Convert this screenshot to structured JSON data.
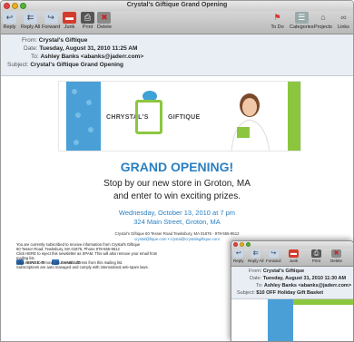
{
  "main_window": {
    "title": "Crystal's Giftique Grand Opening",
    "toolbar_left": [
      {
        "label": "Reply",
        "icon": "reply-icon"
      },
      {
        "label": "Reply All",
        "icon": "reply-all-icon"
      },
      {
        "label": "Forward",
        "icon": "forward-icon"
      },
      {
        "label": "Junk",
        "icon": "junk-icon"
      },
      {
        "label": "Print",
        "icon": "print-icon"
      },
      {
        "label": "Delete",
        "icon": "delete-icon"
      }
    ],
    "toolbar_right": [
      {
        "label": "To Do",
        "icon": "todo-flag-icon"
      },
      {
        "label": "Categories",
        "icon": "categories-icon"
      },
      {
        "label": "Projects",
        "icon": "projects-icon"
      },
      {
        "label": "Links",
        "icon": "links-icon"
      }
    ],
    "headers": {
      "from_label": "From:",
      "from_value": "Crystal's Giftique",
      "date_label": "Date:",
      "date_value": "Tuesday, August 31, 2010 11:25 AM",
      "to_label": "To:",
      "to_value": "Ashley Banks <abanks@jaderr.com>",
      "subject_label": "Subject:",
      "subject_value": "Crystal's Giftique Grand Opening"
    },
    "body": {
      "logo_left": "CHRYSTAL'S",
      "logo_right": "GIFTIQUE",
      "headline": "GRAND OPENING!",
      "line1": "Stop by our new store in Groton, MA",
      "line2": "and enter to win exciting prizes.",
      "when": "Wednesday, October 13, 2010 at 7 pm",
      "where": "324 Main Street, Groton, MA",
      "address": "Crystal's Giftique 60 Tesser Road Tewksbury, MA 01876 - 978-555-9512",
      "contact": "crystal@fique.com • crystal@crystalsgiftique.com",
      "share_buttons": [
        "SHARE IT",
        "SHARE IT"
      ],
      "footer_lines": [
        "You are currently subscribed to receive information from Crystal's Giftique",
        "60 Tesser Road, Tewksbury, MA 01876, Phone 978-555-9512",
        "Click HERE to reject this newsletter as SPAM. This will also remove your email from",
        "mailing list.",
        "Click HERE to remove your email address from this mailing list.",
        "Subscriptions are auto managed and comply with international anti-spam laws."
      ]
    },
    "colors": {
      "accent_blue": "#2a7fc1",
      "lime": "#8cc63f",
      "ribbon_blue": "#4a9fd6"
    }
  },
  "second_window": {
    "toolbar": [
      {
        "label": "Reply",
        "icon": "reply-icon"
      },
      {
        "label": "Reply All",
        "icon": "reply-all-icon"
      },
      {
        "label": "Forward",
        "icon": "forward-icon"
      },
      {
        "label": "Junk",
        "icon": "junk-icon"
      },
      {
        "label": "Print",
        "icon": "print-icon"
      },
      {
        "label": "Delete",
        "icon": "delete-icon"
      }
    ],
    "headers": {
      "from_label": "From:",
      "from_value": "Crystal's Giftique",
      "date_label": "Date:",
      "date_value": "Tuesday, August 31, 2010 11:30 AM",
      "to_label": "To:",
      "to_value": "Ashley Banks <abanks@jaderr.com>",
      "subject_label": "Subject:",
      "subject_value": "$10 OFF Holiday Gift Basket"
    }
  }
}
